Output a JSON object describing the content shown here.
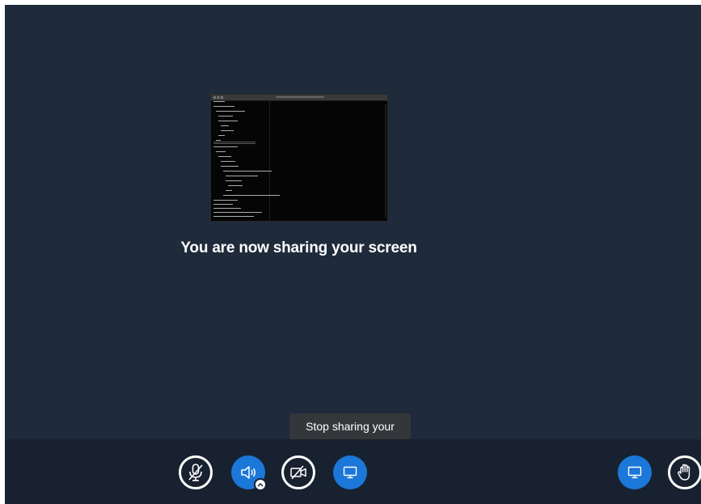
{
  "screen": {
    "status_message": "You are now sharing your screen"
  },
  "tooltip": {
    "text": "Stop sharing your screen"
  },
  "toolbar": {
    "buttons": [
      {
        "name": "mic",
        "icon": "microphone-muted-icon",
        "state": "muted"
      },
      {
        "name": "audio",
        "icon": "speaker-icon",
        "state": "active"
      },
      {
        "name": "camera",
        "icon": "camera-off-icon",
        "state": "off"
      },
      {
        "name": "screenshare",
        "icon": "desktop-icon",
        "state": "active"
      }
    ],
    "right_buttons": [
      {
        "name": "presentation",
        "icon": "desktop-icon",
        "state": "active"
      },
      {
        "name": "raise-hand",
        "icon": "hand-icon",
        "state": "inactive"
      }
    ]
  },
  "colors": {
    "background": "#1f2a3b",
    "toolbar": "#18212f",
    "accent": "#1b77d8",
    "tooltip": "#34373a"
  }
}
